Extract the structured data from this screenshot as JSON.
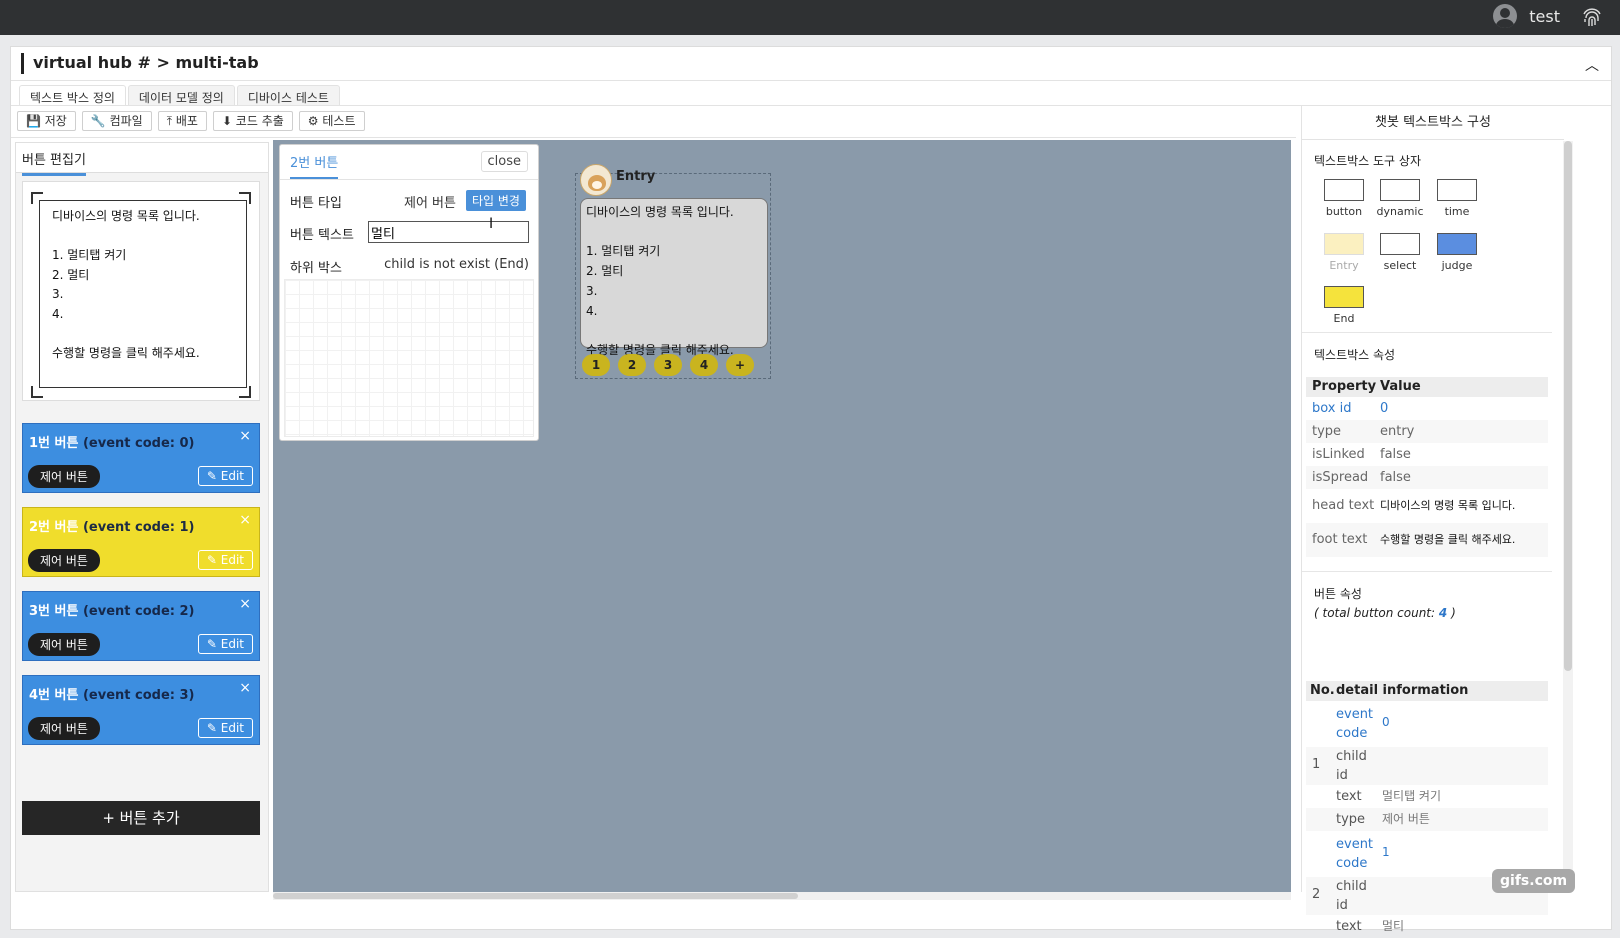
{
  "header": {
    "username": "test"
  },
  "window": {
    "title": "virtual hub # > multi-tab"
  },
  "tabs": [
    "텍스트 박스 정의",
    "데이터 모델 정의",
    "디바이스 테스트"
  ],
  "toolbar": [
    "💾 저장",
    "🔧 컴파일",
    "⤒ 배포",
    "⬇ 코드 추출",
    "⚙ 테스트"
  ],
  "left": {
    "title": "버튼 편집기",
    "preview_text": "디바이스의 명령 목록 입니다.\n\n1. 멀티탭 켜기\n2. 멀티\n3.\n4.\n\n수행할 명령을 클릭 해주세요.",
    "buttons": [
      {
        "name": "1번 버튼",
        "code": "(event code: 0)",
        "pill": "제어 버튼",
        "edit": "✎ Edit"
      },
      {
        "name": "2번 버튼",
        "code": "(event code: 1)",
        "pill": "제어 버튼",
        "edit": "✎ Edit"
      },
      {
        "name": "3번 버튼",
        "code": "(event code: 2)",
        "pill": "제어 버튼",
        "edit": "✎ Edit"
      },
      {
        "name": "4번 버튼",
        "code": "(event code: 3)",
        "pill": "제어 버튼",
        "edit": "✎ Edit"
      }
    ],
    "add_label": "+ 버튼 추가",
    "close_glyph": "×"
  },
  "editor": {
    "tab": "2번 버튼",
    "close": "close",
    "type_label": "버튼 타입",
    "type_value": "제어 버튼",
    "change_label": "타입 변경",
    "text_label": "버튼 텍스트",
    "text_value": "멀티",
    "child_label": "하위 박스",
    "child_value": "child is not exist (End)"
  },
  "node": {
    "title": "Entry",
    "text": "디바이스의 명령 목록 입니다.\n\n1. 멀티탭 켜기\n2. 멀티\n3.\n4.\n\n수행할 명령을 클릭 해주세요.",
    "chips": [
      "1",
      "2",
      "3",
      "4",
      "+"
    ]
  },
  "right": {
    "title": "챗봇 텍스트박스 구성",
    "toolbox_title": "텍스트박스 도구 상자",
    "tools": [
      {
        "label": "button",
        "color": "#ffffff"
      },
      {
        "label": "dynamic",
        "color": "#ffffff"
      },
      {
        "label": "time",
        "color": "#ffffff"
      },
      {
        "label": "Entry",
        "color": "#fbf0c0"
      },
      {
        "label": "select",
        "color": "#ffffff"
      },
      {
        "label": "judge",
        "color": "#5b8ee0"
      },
      {
        "label": "End",
        "color": "#f5e33c"
      }
    ],
    "props_title": "텍스트박스 속성",
    "prop_header": [
      "Property",
      "Value"
    ],
    "props": [
      {
        "k": "box id",
        "v": "0"
      },
      {
        "k": "type",
        "v": "entry"
      },
      {
        "k": "isLinked",
        "v": "false"
      },
      {
        "k": "isSpread",
        "v": "false"
      },
      {
        "k": "head text",
        "v": "디바이스의 명령 목록 입니다."
      },
      {
        "k": "foot text",
        "v": "수행할 명령을 클릭 해주세요."
      }
    ],
    "btn_props_title": "버튼 속성",
    "btn_count_prefix": "( total button count:",
    "btn_count": "4",
    "btn_count_suffix": ")",
    "detail_header": [
      "No.",
      "detail information"
    ],
    "details": [
      {
        "no": "1",
        "event_k": "event code",
        "event_v": "0",
        "child_k": "child id",
        "text_k": "text",
        "text_v": "멀티탭 켜기",
        "type_k": "type",
        "type_v": "제어 버튼"
      },
      {
        "no": "2",
        "event_k": "event code",
        "event_v": "1",
        "child_k": "child id",
        "text_k": "text",
        "text_v": "멀티"
      }
    ]
  },
  "watermark": "gifs.com"
}
